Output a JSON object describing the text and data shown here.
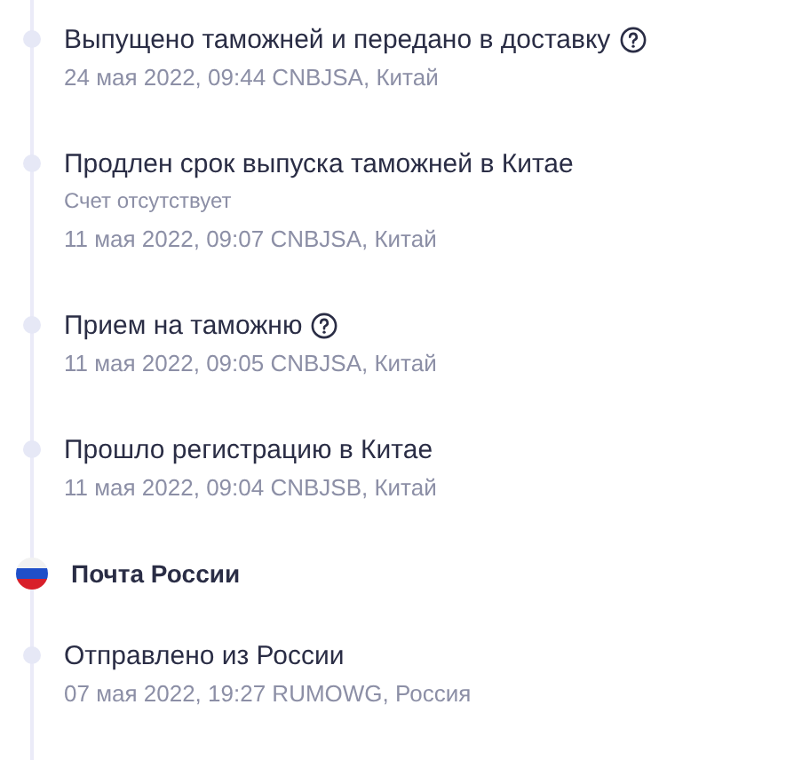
{
  "events": [
    {
      "title": "Выпущено таможней и передано в доставку",
      "help": true,
      "date": "24 мая 2022, 09:44 CNBJSA, Китай"
    },
    {
      "title": "Продлен срок выпуска таможней в Китае",
      "help": false,
      "note": "Счет отсутствует",
      "date": "11 мая 2022, 09:07 CNBJSA, Китай"
    },
    {
      "title": "Прием на таможню",
      "help": true,
      "date": "11 мая 2022, 09:05 CNBJSA, Китай"
    },
    {
      "title": "Прошло регистрацию в Китае",
      "help": false,
      "date": "11 мая 2022, 09:04 CNBJSB, Китай"
    }
  ],
  "carriers": [
    {
      "name": "Почта России",
      "events": [
        {
          "title": "Отправлено из России",
          "help": false,
          "date": "07 мая 2022, 19:27 RUMOWG, Россия"
        }
      ]
    }
  ]
}
